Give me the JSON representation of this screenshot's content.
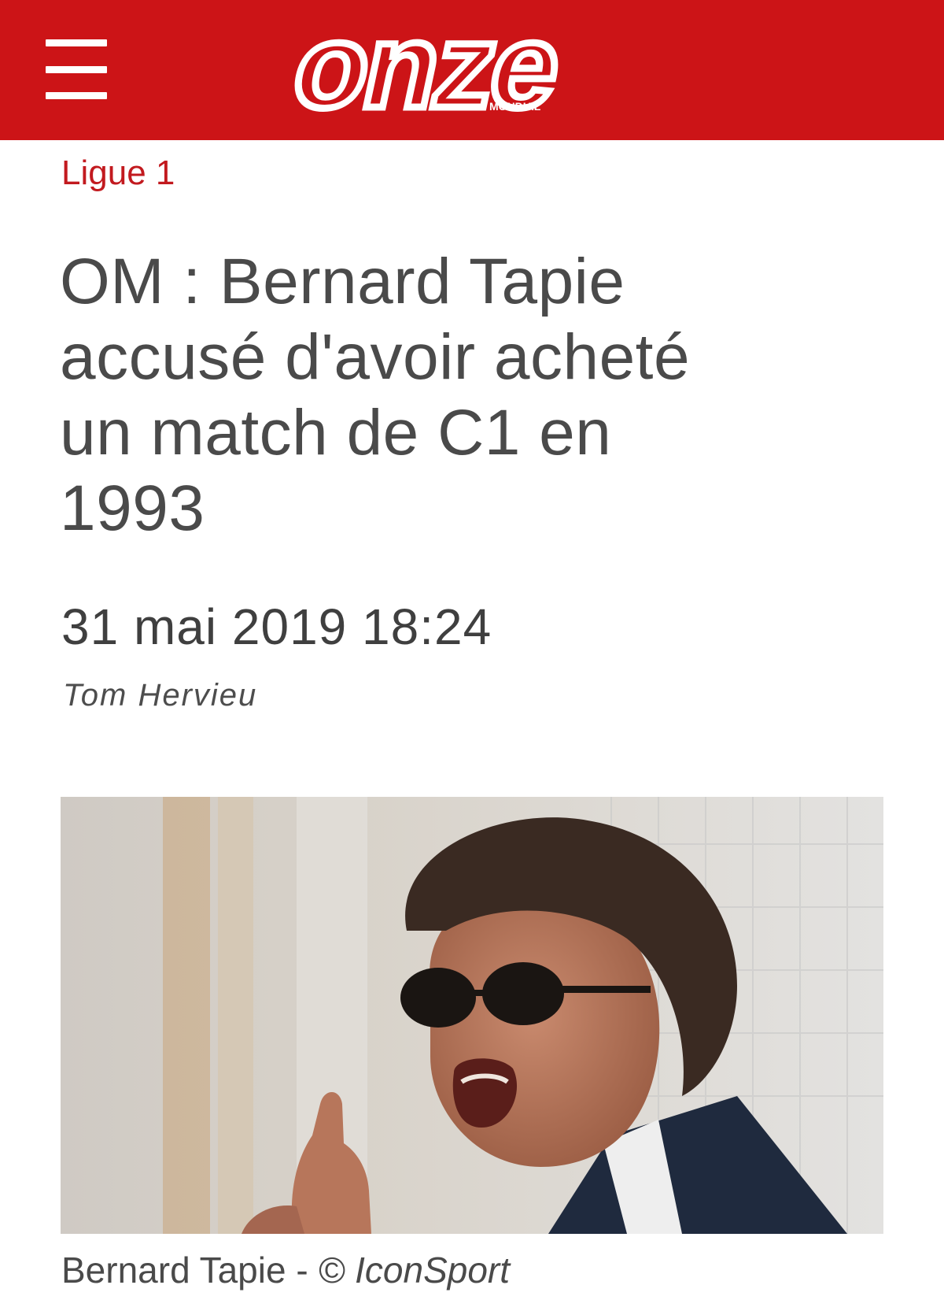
{
  "header": {
    "menu_icon": "hamburger-menu-icon",
    "logo": {
      "text": "onze",
      "subtext": "MONDIAL"
    },
    "colors": {
      "brand_red": "#cc1417"
    }
  },
  "article": {
    "category": "Ligue 1",
    "headline_lines": [
      "OM : Bernard Tapie",
      "accusé d'avoir acheté",
      "un match de C1 en",
      "1993"
    ],
    "date": "31 mai 2019 18:24",
    "author": "Tom Hervieu",
    "photo": {
      "caption_name": "Bernard Tapie - ",
      "caption_credit": "© IconSport"
    }
  }
}
